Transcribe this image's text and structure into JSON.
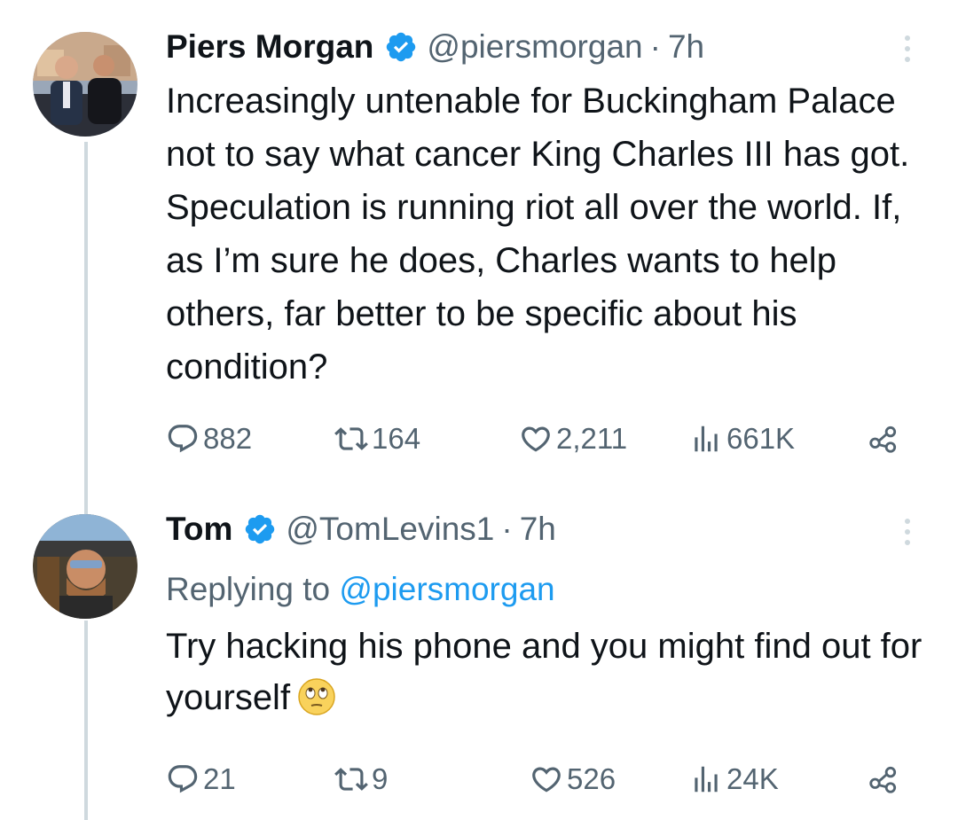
{
  "tweets": [
    {
      "name": "Piers Morgan",
      "handle": "@piersmorgan",
      "separator": "·",
      "time": "7h",
      "verified": true,
      "text": "Increasingly untenable for Buckingham Palace not to say what cancer King Charles III has got. Speculation is running riot all over the world. If, as I’m sure he does, Charles wants to help others, far better to be specific about his condition?",
      "replies": "882",
      "reposts": "164",
      "likes": "2,211",
      "views": "661K"
    },
    {
      "name": "Tom",
      "handle": "@TomLevins1",
      "separator": "·",
      "time": "7h",
      "verified": true,
      "replying_label": "Replying to",
      "replying_to": "@piersmorgan",
      "text": "Try hacking his phone and you might find out for yourself",
      "emoji": "face-with-rolling-eyes",
      "replies": "21",
      "reposts": "9",
      "likes": "526",
      "views": "24K"
    }
  ],
  "icons": {
    "reply": "reply-icon",
    "repost": "repost-icon",
    "like": "like-icon",
    "views": "views-icon",
    "share": "share-icon",
    "verified": "verified-badge-icon",
    "more": "more-options-icon"
  },
  "colors": {
    "text": "#0f1419",
    "muted": "#536471",
    "link": "#1d9bf0",
    "verified": "#1d9bf0",
    "thread_line": "#cfd9de"
  }
}
